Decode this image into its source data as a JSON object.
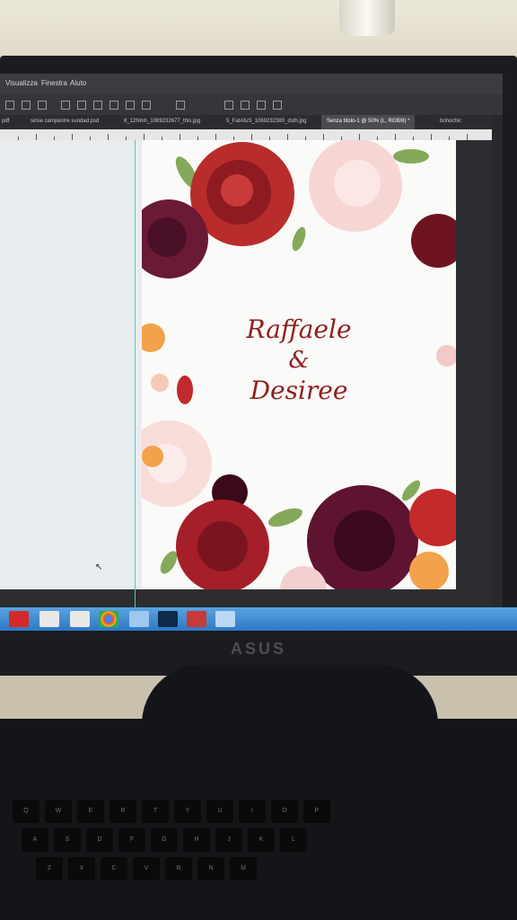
{
  "menu": {
    "items": [
      "Visualizza",
      "Finestra",
      "Aiuto"
    ]
  },
  "tabs": [
    {
      "label": "pdf",
      "active": false
    },
    {
      "label": "sinse campestre sundad.psd",
      "active": false
    },
    {
      "label": "8_12Nmh_1069232677_this.jpg",
      "active": false
    },
    {
      "label": "5_FatAfuS_1069232380_dsth.jpg",
      "active": false
    },
    {
      "label": "Senza titolo-1 @ 50% (L, RGB/8) *",
      "active": true
    },
    {
      "label": "bohochic",
      "active": false
    }
  ],
  "document": {
    "name1": "Raffaele",
    "amp": "&",
    "name2": "Desiree",
    "text_color": "#8e1f1f"
  },
  "monitor": {
    "brand": "ASUS"
  },
  "keyboard": {
    "keys": [
      "Q",
      "W",
      "E",
      "R",
      "T",
      "Y",
      "U",
      "I",
      "O",
      "P",
      "A",
      "S",
      "D",
      "F",
      "G",
      "H",
      "J",
      "K",
      "L",
      "Z",
      "X",
      "C",
      "V",
      "B",
      "N",
      "M"
    ]
  },
  "colors": {
    "taskbar": "#2d78c4",
    "guide": "#4fc7c0"
  }
}
